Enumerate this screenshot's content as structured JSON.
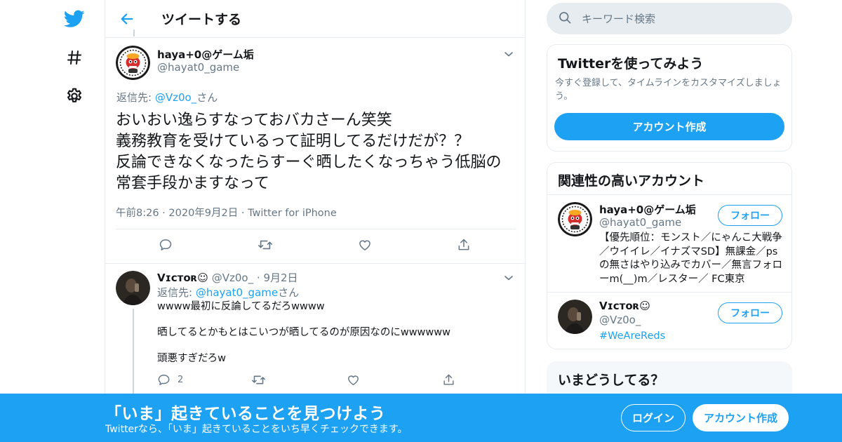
{
  "colors": {
    "accent": "#1da1f2",
    "text": "#14171a",
    "secondary": "#657786",
    "border": "#e6ecf0",
    "banner": "#1da1f2"
  },
  "nav": {
    "icons": [
      "twitter-bird-icon",
      "hashtag-icon",
      "gear-icon"
    ]
  },
  "header": {
    "title": "ツイートする",
    "back_icon": "arrow-left-icon"
  },
  "focal_tweet": {
    "author_name": "haya+0@ゲーム垢",
    "author_handle": "@hayat0_game",
    "reply_prefix": "返信先: ",
    "reply_handle": "@Vz0o_",
    "reply_suffix": "さん",
    "text": "おいおい逸らすなっておバカさーん笑笑\n義務教育を受けているって証明してるだけだが？？\n反論できなくなったらすーぐ晒したくなっちゃう低脳の常套手段かますなって",
    "time": "午前8:26",
    "date": "2020年9月2日",
    "source": "Twitter for iPhone",
    "sep": "·"
  },
  "reply_tweet": {
    "author_name": "Vɪᴄᴛᴏʀ☺︎",
    "author_handle": "@Vz0o_",
    "sep": "·",
    "date": "9月2日",
    "reply_prefix": "返信先: ",
    "reply_handle": "@hayat0_game",
    "reply_suffix": "さん",
    "lines": [
      "wwww最初に反論してるだろwwww",
      "晒してるとかもとはこいつが晒してるのが原因なのにwwwwww",
      "頭悪すぎだろw"
    ],
    "reply_count": "2"
  },
  "search": {
    "placeholder": "キーワード検索"
  },
  "signup_card": {
    "title": "Twitterを使ってみよう",
    "description": "今すぐ登録して、タイムラインをカスタマイズしましょう。",
    "button": "アカウント作成"
  },
  "related_card": {
    "title": "関連性の高いアカウント",
    "accounts": [
      {
        "name": "haya+0@ゲーム垢",
        "handle": "@hayat0_game",
        "follow": "フォロー",
        "bio": "【優先順位：モンスト／にゃんこ大戦争／ウイイレ／イナズマSD】無課金／psの無さはやり込みでカバー／無言フォローm(__)m／レスター／ FC東京"
      },
      {
        "name": "Vɪᴄᴛᴏʀ☺︎",
        "handle": "@Vz0o_",
        "follow": "フォロー",
        "bio": "#WeAreReds"
      }
    ]
  },
  "trend_card": {
    "title": "いまどうしてる？"
  },
  "banner": {
    "title": "「いま」起きていることを見つけよう",
    "subtitle": "Twitterなら、「いま」起きていることをいち早くチェックできます。",
    "login": "ログイン",
    "signup": "アカウント作成"
  }
}
